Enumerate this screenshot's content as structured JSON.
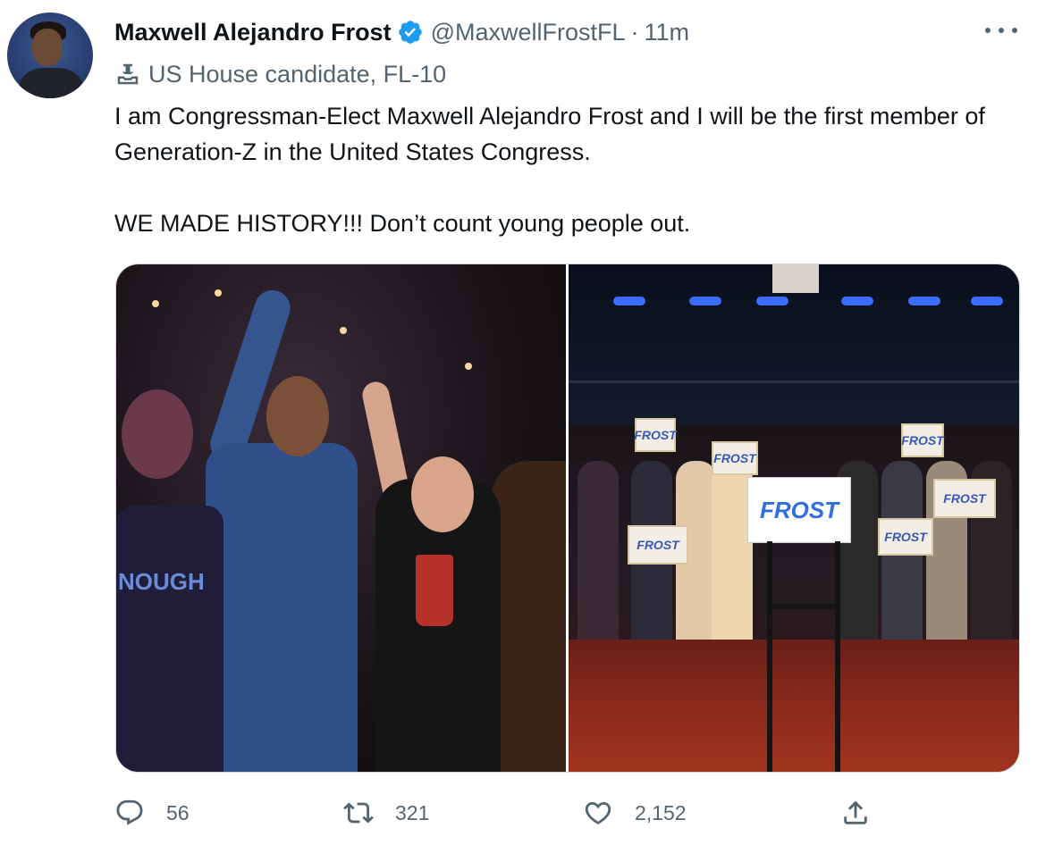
{
  "author": {
    "display_name": "Maxwell Alejandro Frost",
    "handle": "@MaxwellFrostFL",
    "separator": "·",
    "time": "11m",
    "verified": true,
    "label": "US House candidate, FL-10",
    "label_icon": "ballot-box-icon"
  },
  "tweet": {
    "paragraph_1": "I am Congressman-Elect Maxwell Alejandro Frost and I will be the first member of Generation-Z in the United States Congress.",
    "paragraph_2": "WE MADE HISTORY!!! Don’t count young people out."
  },
  "media": {
    "photos": [
      {
        "name": "celebration-photo",
        "shirt_text": "NOUGH"
      },
      {
        "name": "stage-rally-photo",
        "podium_sign_text": "FROST",
        "sign_text": "FROST"
      }
    ]
  },
  "actions": {
    "reply_count": "56",
    "retweet_count": "321",
    "like_count": "2,152"
  },
  "colors": {
    "text_primary": "#0f1419",
    "text_secondary": "#536471",
    "verified_blue": "#1d9bf0",
    "border": "#cfd9de"
  }
}
